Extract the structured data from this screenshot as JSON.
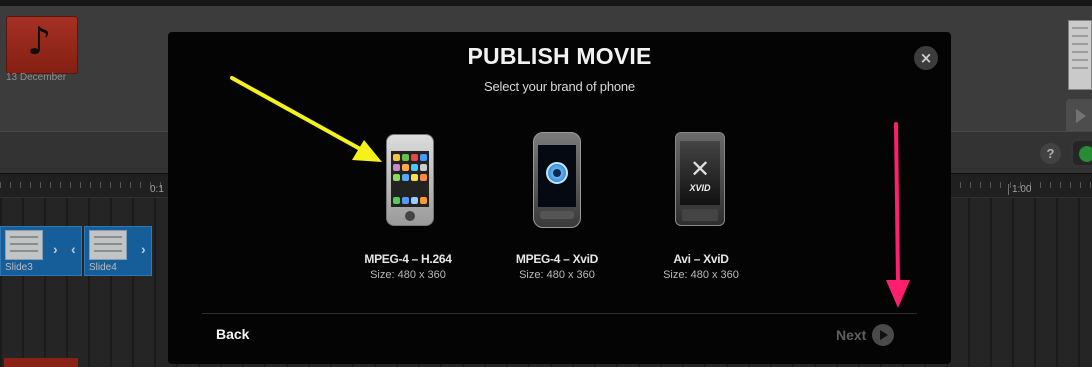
{
  "editor": {
    "media_item_date": "13 December",
    "ruler_labels": [
      "0:1",
      "1:00"
    ],
    "slides": [
      {
        "label": "Slide3"
      },
      {
        "label": "Slide4"
      }
    ],
    "help_label": "?"
  },
  "modal": {
    "title": "PUBLISH MOVIE",
    "subtitle": "Select your brand of phone",
    "close_label": "×",
    "options": [
      {
        "title": "MPEG-4 – H.264",
        "size": "Size: 480 x 360",
        "icon": "iphone-icon"
      },
      {
        "title": "MPEG-4 – XviD",
        "size": "Size: 480 x 360",
        "icon": "quicktime-phone-icon"
      },
      {
        "title": "Avi – XviD",
        "size": "Size: 480 x 360",
        "icon": "xvid-phone-icon"
      }
    ],
    "back_label": "Back",
    "next_label": "Next"
  },
  "annotations": {
    "arrow_yellow_color": "#f5f21a",
    "arrow_pink_color": "#ff1f6e"
  },
  "colors": {
    "modal_bg": "#040404",
    "slide_blue": "#1b6fb4",
    "music_red": "#c23a2a"
  }
}
